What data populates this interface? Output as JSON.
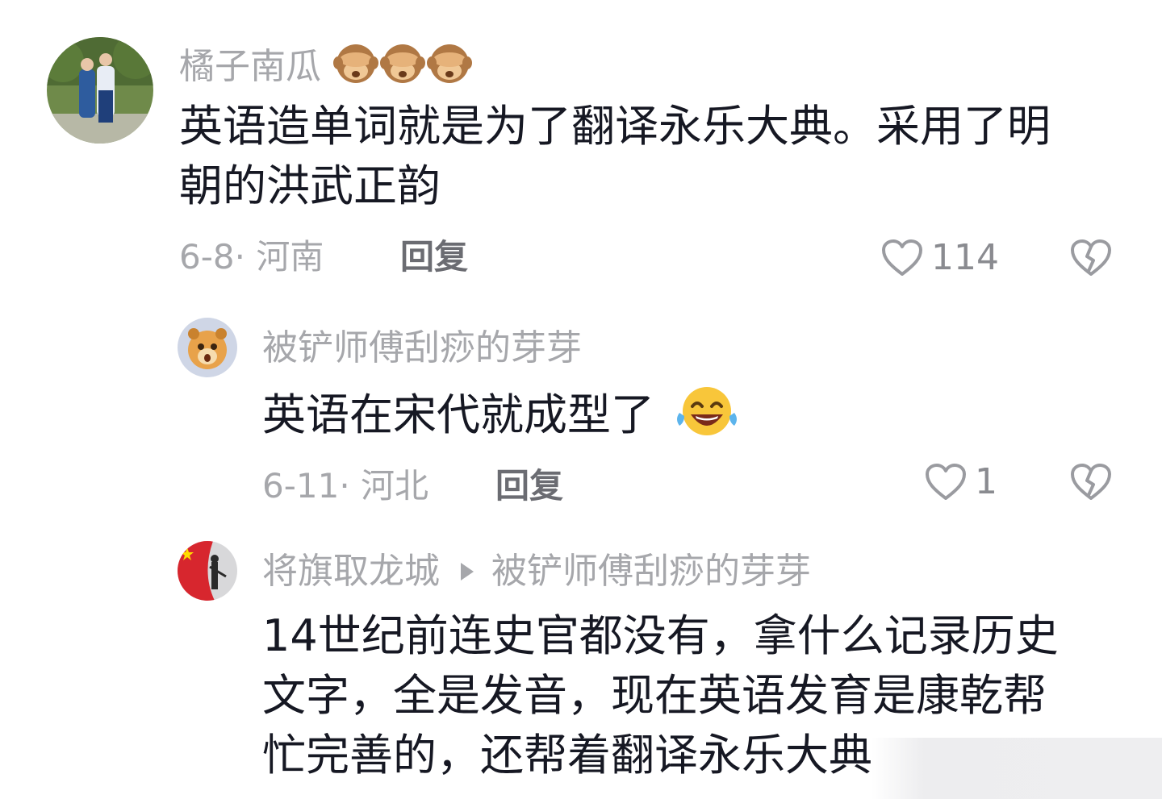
{
  "comments": [
    {
      "user": "橘子南瓜",
      "user_emojis": [
        "see-no-evil-monkey",
        "see-no-evil-monkey",
        "see-no-evil-monkey"
      ],
      "text_lines": [
        "英语造单词就是为了翻译永乐大典。采用了明",
        "朝的洪武正韵"
      ],
      "date": "6-8",
      "location": "河南",
      "reply_label": "回复",
      "likes": "114"
    },
    {
      "user": "被铲师傅刮痧的芽芽",
      "text": "英语在宋代就成型了",
      "text_emoji": "laughing-tears-face",
      "date": "6-11",
      "location": "河北",
      "reply_label": "回复",
      "likes": "1"
    },
    {
      "user": "将旗取龙城",
      "reply_to": "被铲师傅刮痧的芽芽",
      "text_lines": [
        "14世纪前连史官都没有，拿什么记录历史",
        "文字，全是发音，现在英语发育是康乾帮",
        "忙完善的，还帮着翻译永乐大典"
      ]
    }
  ],
  "meta_separator": "·",
  "colors": {
    "text": "#161823",
    "secondary": "#a6a7ab",
    "reply": "#6b6c72"
  }
}
